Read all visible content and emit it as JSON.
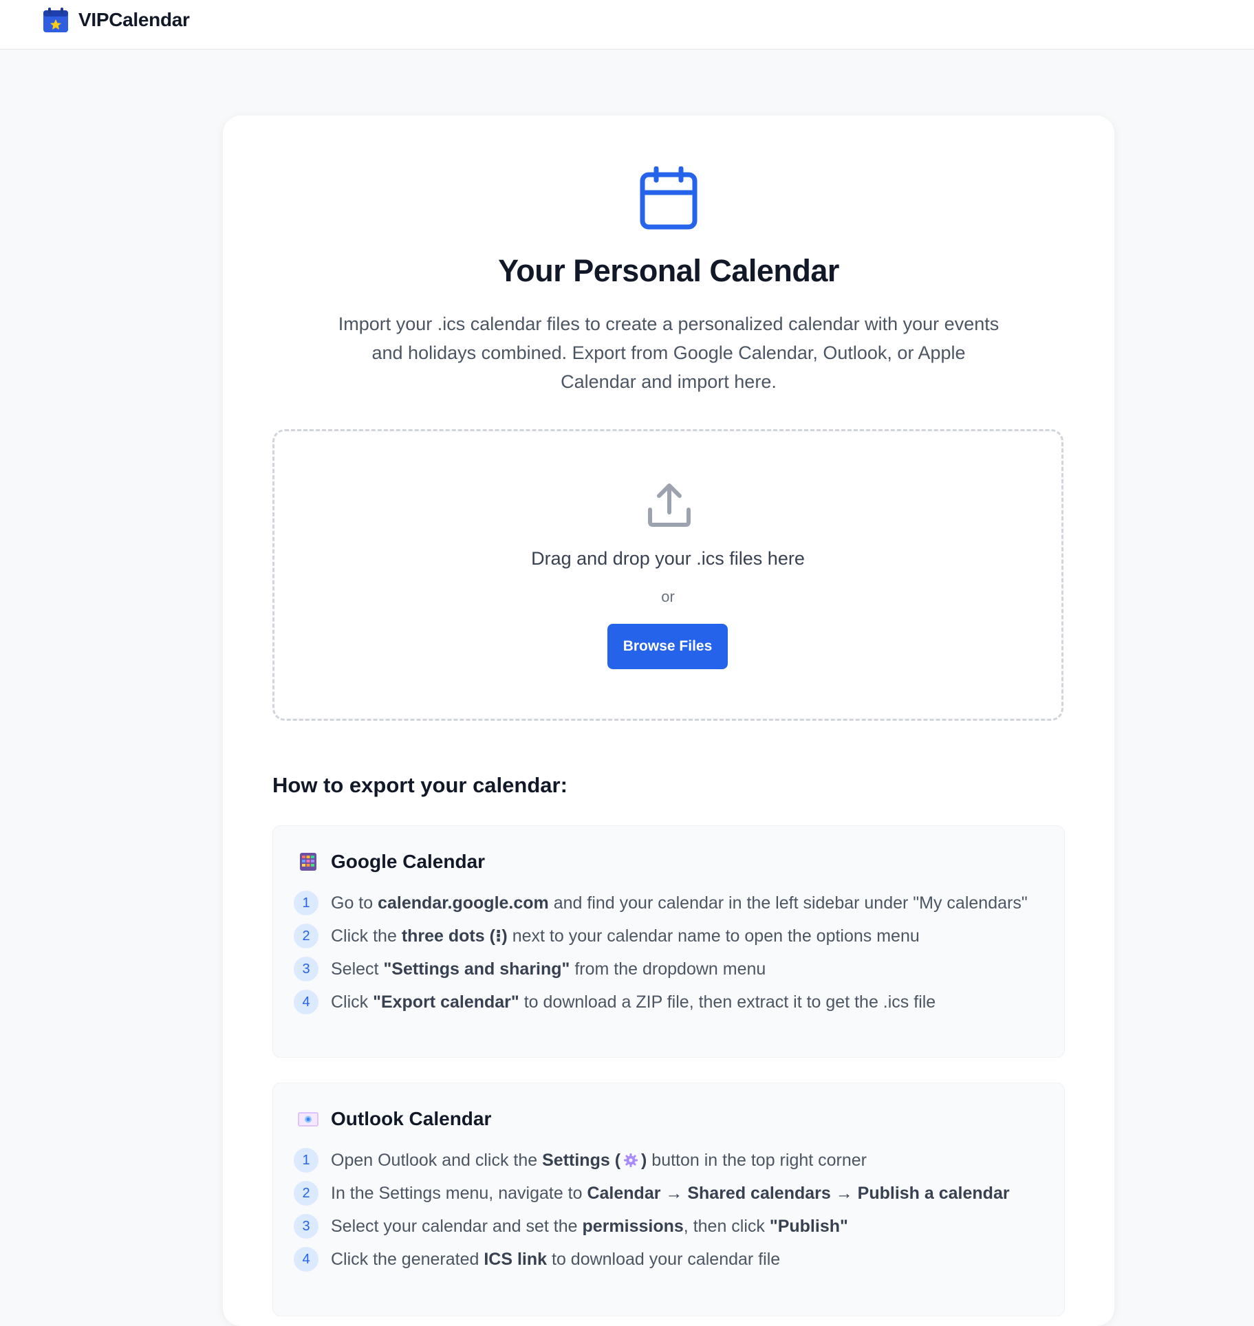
{
  "app": {
    "name": "VIPCalendar",
    "logo_icon": "calendar-star-icon"
  },
  "colors": {
    "accent": "#2563eb",
    "accent_light": "#dbeafe",
    "page_bg": "#f8f9fa",
    "card_bg": "#ffffff"
  },
  "hero": {
    "icon": "calendar-icon",
    "title": "Your Personal Calendar",
    "description": "Import your .ics calendar files to create a personalized calendar with your events and holidays combined. Export from Google Calendar, Outlook, or Apple Calendar and import here."
  },
  "dropzone": {
    "icon": "upload-icon",
    "text": "Drag and drop your .ics files here",
    "or": "or",
    "button_label": "Browse Files"
  },
  "export_guide": {
    "title": "How to export your calendar:",
    "google": {
      "icon": "google-calendar-icon",
      "name": "Google Calendar",
      "steps": [
        {
          "num": "1",
          "a": "Go to ",
          "b1": "calendar.google.com",
          "c": " and find your calendar in the left sidebar under \"My calendars\""
        },
        {
          "num": "2",
          "a": "Click the ",
          "b1": "three dots (⁝)",
          "c": " next to your calendar name to open the options menu"
        },
        {
          "num": "3",
          "a": "Select ",
          "b1": "\"Settings and sharing\"",
          "c": " from the dropdown menu"
        },
        {
          "num": "4",
          "a": "Click ",
          "b1": "\"Export calendar\"",
          "c": " to download a ZIP file, then extract it to get the .ics file"
        }
      ]
    },
    "outlook": {
      "icon": "outlook-calendar-icon",
      "name": "Outlook Calendar",
      "steps": [
        {
          "num": "1",
          "a": "Open Outlook and click the ",
          "b1": "Settings (",
          "gear_icon": "gear-icon",
          "b2": ")",
          "c": " button in the top right corner"
        },
        {
          "num": "2",
          "a": "In the Settings menu, navigate to ",
          "b1": "Calendar → Shared calendars → Publish a calendar",
          "c": ""
        },
        {
          "num": "3",
          "a": "Select your calendar and set the ",
          "b1": "permissions",
          "c": ", then click ",
          "b2": "\"Publish\""
        },
        {
          "num": "4",
          "a": "Click the generated ",
          "b1": "ICS link",
          "c": " to download your calendar file"
        }
      ]
    }
  }
}
